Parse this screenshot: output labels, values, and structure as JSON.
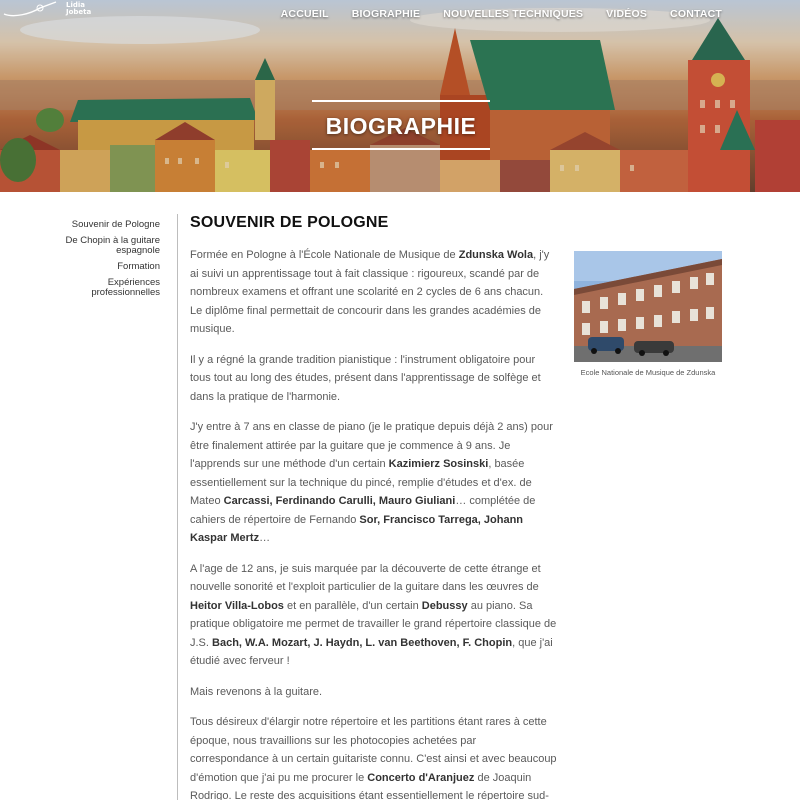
{
  "logo": {
    "text": "Lidia\nJobeta"
  },
  "nav": {
    "items": [
      "ACCUEIL",
      "BIOGRAPHIE",
      "NOUVELLES TECHNIQUES",
      "VIDÉOS",
      "CONTACT"
    ]
  },
  "hero": {
    "title": "BIOGRAPHIE"
  },
  "sidebar": {
    "items": [
      {
        "label": "Souvenir de Pologne"
      },
      {
        "label": "De Chopin à la guitare espagnole"
      },
      {
        "label": "Formation"
      },
      {
        "label": "Expériences professionnelles"
      }
    ]
  },
  "main": {
    "title": "SOUVENIR DE POLOGNE",
    "paragraphs": [
      [
        {
          "t": "Formée en Pologne à l'École Nationale de Musique de "
        },
        {
          "t": "Zdunska Wola",
          "b": true
        },
        {
          "t": ", j'y ai suivi un apprentissage tout à fait classique : rigoureux, scandé par de nombreux examens et offrant une scolarité en 2 cycles de 6 ans chacun. Le diplôme final permettait de concourir dans les grandes académies de musique."
        }
      ],
      [
        {
          "t": "Il y a régné la grande tradition pianistique : l'instrument obligatoire pour tous tout au long des études, présent dans l'apprentissage de solfège et dans la pratique de l'harmonie."
        }
      ],
      [
        {
          "t": "J'y entre à 7 ans en classe de piano (je le pratique depuis déjà 2 ans) pour être finalement attirée par la guitare que je commence à 9 ans. Je l'apprends sur une méthode d'un certain "
        },
        {
          "t": "Kazimierz Sosinski",
          "b": true
        },
        {
          "t": ", basée essentiellement sur la technique du pincé, remplie d'études et d'ex. de Mateo "
        },
        {
          "t": "Carcassi, Ferdinando Carulli, Mauro Giuliani",
          "b": true
        },
        {
          "t": "… complétée de cahiers de répertoire de Fernando "
        },
        {
          "t": "Sor, Francisco Tarrega, Johann Kaspar Mertz",
          "b": true
        },
        {
          "t": "…"
        }
      ],
      [
        {
          "t": "A l'age de 12 ans, je suis marquée par la découverte de cette étrange et nouvelle sonorité et l'exploit particulier de la guitare dans les œuvres de "
        },
        {
          "t": "Heitor Villa-Lobos",
          "b": true
        },
        {
          "t": " et en parallèle, d'un certain "
        },
        {
          "t": "Debussy",
          "b": true
        },
        {
          "t": " au piano. Sa pratique obligatoire me permet de travailler le grand répertoire classique de J.S. "
        },
        {
          "t": "Bach, W.A. Mozart, J. Haydn, L. van Beethoven, F. Chopin",
          "b": true
        },
        {
          "t": ", que j'ai étudié avec ferveur !"
        }
      ],
      [
        {
          "t": "Mais revenons à la guitare."
        }
      ],
      [
        {
          "t": "Tous désireux d'élargir notre répertoire et les partitions étant rares à cette époque, nous travaillions sur les photocopies achetées par correspondance à un certain guitariste connu. C'est ainsi et avec beaucoup d'émotion que j'ai pu me procurer le "
        },
        {
          "t": "Concerto d'Aranjuez",
          "b": true
        },
        {
          "t": " de Joaquin Rodrigo. Le reste des acquisitions étant essentiellement le répertoire sud-américain très populaire et apprécié par les jeunes futurs professionnels."
        }
      ]
    ]
  },
  "figure": {
    "caption": "Ecole Nationale de Musique de Zdunska"
  },
  "colors": {
    "text": "#5a5a5a",
    "heading": "#111111",
    "rule": "#bdbdbd",
    "nav": "#ffffff"
  }
}
